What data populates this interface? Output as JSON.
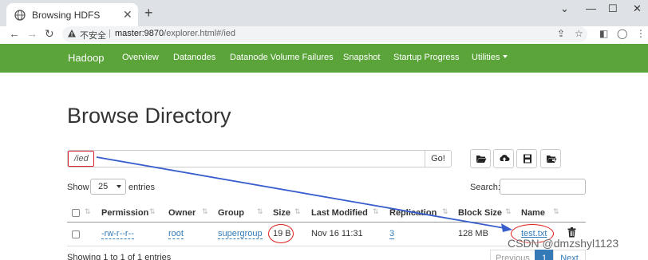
{
  "browser": {
    "tab_title": "Browsing HDFS",
    "security_label": "不安全",
    "url_host": "master:9870",
    "url_path": "/explorer.html#/ied",
    "controls": {
      "minimize": "⌄",
      "restore": "—",
      "maximize": "☐",
      "close": "✕"
    }
  },
  "navbar": {
    "brand": "Hadoop",
    "items": [
      "Overview",
      "Datanodes",
      "Datanode Volume Failures",
      "Snapshot",
      "Startup Progress",
      "Utilities"
    ]
  },
  "page": {
    "title": "Browse Directory",
    "path_value": "/ied",
    "go_label": "Go!",
    "show_label": "Show",
    "entries_value": "25",
    "entries_label": "entries",
    "search_label": "Search:",
    "search_value": ""
  },
  "table": {
    "headers": [
      "Permission",
      "Owner",
      "Group",
      "Size",
      "Last Modified",
      "Replication",
      "Block Size",
      "Name"
    ],
    "rows": [
      {
        "permission": "-rw-r--r--",
        "owner": "root",
        "group": "supergroup",
        "size": "19 B",
        "last_modified": "Nov 16 11:31",
        "replication": "3",
        "block_size": "128 MB",
        "name": "test.txt"
      }
    ]
  },
  "footer": {
    "info": "Showing 1 to 1 of 1 entries",
    "prev": "Previous",
    "page": "1",
    "next": "Next"
  },
  "watermark": "CSDN @dmzshyl1123",
  "colors": {
    "navbar": "#5aa43a",
    "link": "#337ab7",
    "highlight": "#e02020",
    "arrow": "#3a5fcd",
    "active_page": "#337ab7"
  }
}
